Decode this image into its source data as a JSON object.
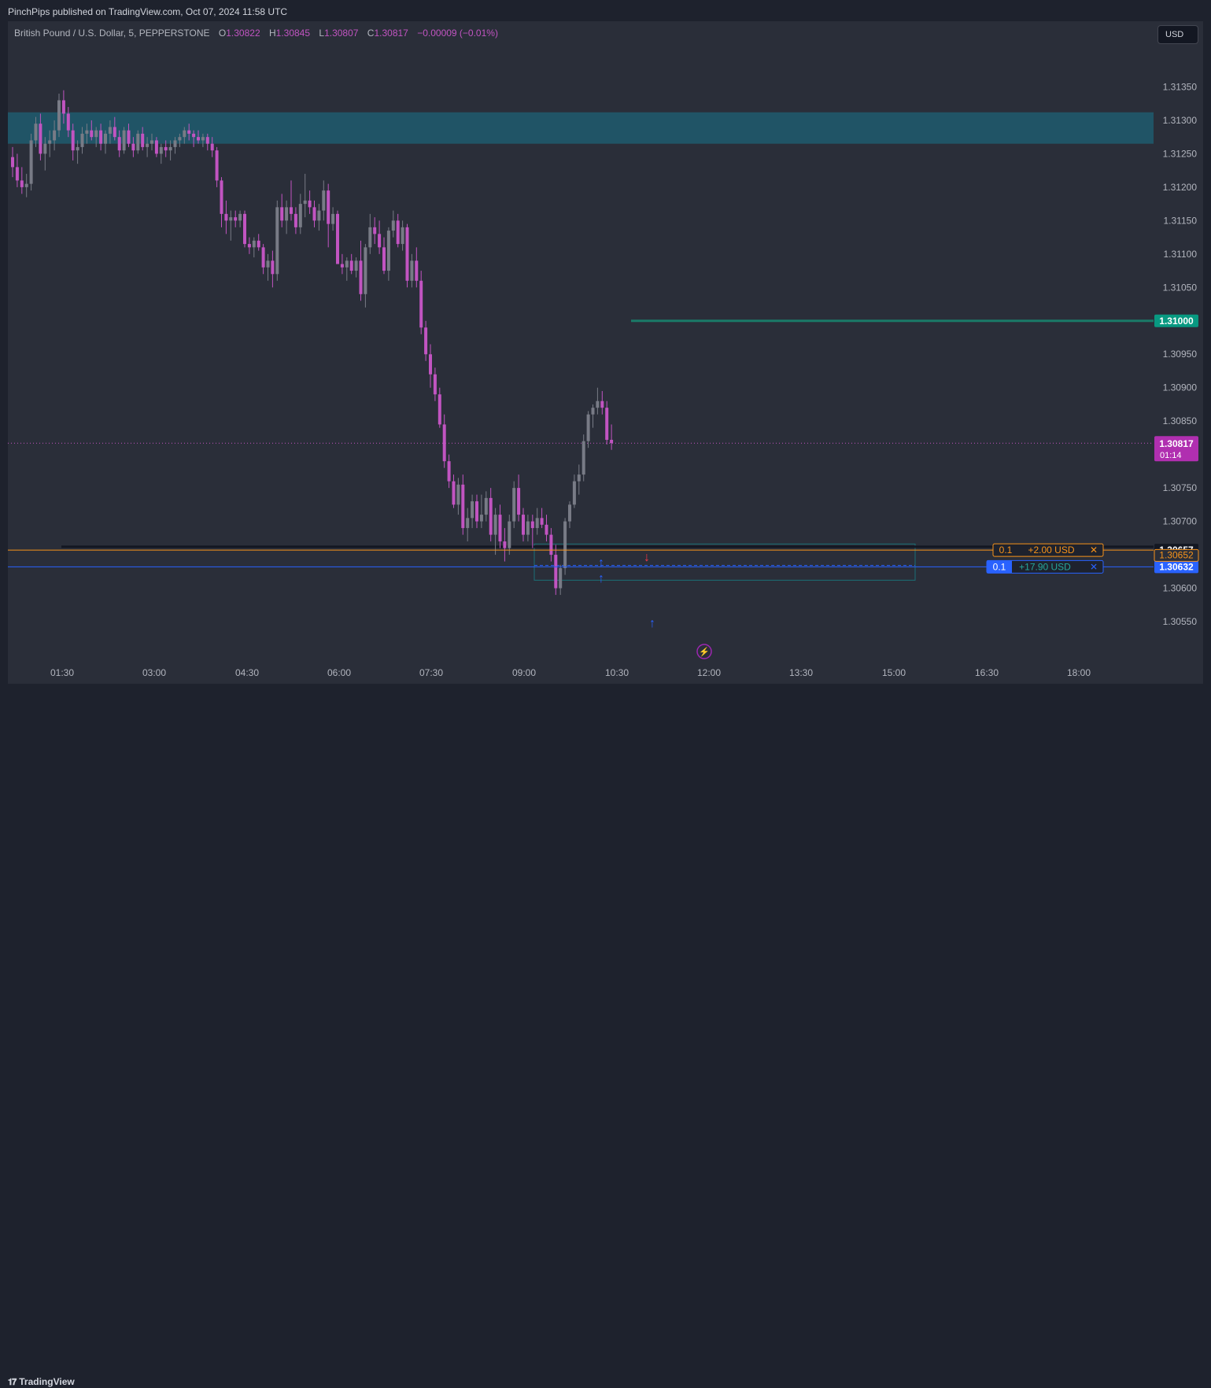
{
  "header": {
    "published": "PinchPips published on TradingView.com, Oct 07, 2024 11:58 UTC"
  },
  "legend": {
    "symbol": "British Pound / U.S. Dollar, 5, PEPPERSTONE",
    "open_label": "O",
    "open": "1.30822",
    "high_label": "H",
    "high": "1.30845",
    "low_label": "L",
    "low": "1.30807",
    "close_label": "C",
    "close": "1.30817",
    "change": "−0.00009 (−0.01%)"
  },
  "currency_button": "USD",
  "footer": {
    "brand": "TradingView"
  },
  "chart_data": {
    "type": "candlestick",
    "x_ticks": [
      "01:30",
      "03:00",
      "04:30",
      "06:00",
      "07:30",
      "09:00",
      "10:30",
      "12:00",
      "13:30",
      "15:00",
      "16:30",
      "18:00"
    ],
    "y_ticks": [
      "1.31350",
      "1.31300",
      "1.31250",
      "1.31200",
      "1.31150",
      "1.31100",
      "1.31050",
      "1.30950",
      "1.30900",
      "1.30850",
      "1.30750",
      "1.30700",
      "1.30600",
      "1.30550"
    ],
    "ylim": [
      1.3051,
      1.3142
    ],
    "colors": {
      "up": "#787b86",
      "down": "#c154c1",
      "zone": "#1f5b6e",
      "level": "#1a7a68",
      "order": "#f7931a",
      "position": "#2962ff"
    },
    "candles_ohlc": [
      [
        1.31245,
        1.3126,
        1.31215,
        1.3123
      ],
      [
        1.3123,
        1.3125,
        1.312,
        1.3121
      ],
      [
        1.3121,
        1.3123,
        1.3119,
        1.312
      ],
      [
        1.312,
        1.3122,
        1.31185,
        1.31205
      ],
      [
        1.31205,
        1.3128,
        1.31195,
        1.3127
      ],
      [
        1.3127,
        1.31305,
        1.3126,
        1.31295
      ],
      [
        1.31295,
        1.3131,
        1.3124,
        1.3125
      ],
      [
        1.3125,
        1.31275,
        1.31225,
        1.31265
      ],
      [
        1.31265,
        1.31285,
        1.31245,
        1.3127
      ],
      [
        1.3127,
        1.313,
        1.31255,
        1.31285
      ],
      [
        1.31285,
        1.3134,
        1.31275,
        1.3133
      ],
      [
        1.3133,
        1.31345,
        1.31295,
        1.3131
      ],
      [
        1.3131,
        1.3132,
        1.31275,
        1.31285
      ],
      [
        1.31285,
        1.31295,
        1.3124,
        1.31255
      ],
      [
        1.31255,
        1.3127,
        1.31235,
        1.3126
      ],
      [
        1.3126,
        1.3129,
        1.3125,
        1.3128
      ],
      [
        1.3128,
        1.31295,
        1.31265,
        1.31285
      ],
      [
        1.31285,
        1.313,
        1.3127,
        1.31275
      ],
      [
        1.31275,
        1.3129,
        1.3126,
        1.31285
      ],
      [
        1.31285,
        1.31295,
        1.31255,
        1.31265
      ],
      [
        1.31265,
        1.31285,
        1.3125,
        1.3128
      ],
      [
        1.3128,
        1.313,
        1.31265,
        1.3129
      ],
      [
        1.3129,
        1.31305,
        1.3127,
        1.31275
      ],
      [
        1.31275,
        1.31285,
        1.31245,
        1.31255
      ],
      [
        1.31255,
        1.3129,
        1.3125,
        1.31285
      ],
      [
        1.31285,
        1.31295,
        1.3126,
        1.31265
      ],
      [
        1.31265,
        1.31275,
        1.31245,
        1.31255
      ],
      [
        1.31255,
        1.31285,
        1.3125,
        1.3128
      ],
      [
        1.3128,
        1.3129,
        1.31255,
        1.3126
      ],
      [
        1.3126,
        1.31275,
        1.31245,
        1.31265
      ],
      [
        1.31265,
        1.3128,
        1.31255,
        1.3127
      ],
      [
        1.3127,
        1.31275,
        1.31245,
        1.3125
      ],
      [
        1.3125,
        1.31265,
        1.31235,
        1.3126
      ],
      [
        1.3126,
        1.3127,
        1.31245,
        1.31255
      ],
      [
        1.31255,
        1.3127,
        1.3124,
        1.3126
      ],
      [
        1.3126,
        1.31275,
        1.3125,
        1.3127
      ],
      [
        1.3127,
        1.3128,
        1.3126,
        1.31275
      ],
      [
        1.31275,
        1.3129,
        1.31265,
        1.31285
      ],
      [
        1.31285,
        1.31295,
        1.3127,
        1.3128
      ],
      [
        1.3128,
        1.31285,
        1.3126,
        1.31275
      ],
      [
        1.31275,
        1.31285,
        1.31265,
        1.3127
      ],
      [
        1.3127,
        1.3128,
        1.3126,
        1.31275
      ],
      [
        1.31275,
        1.3128,
        1.31255,
        1.31265
      ],
      [
        1.31265,
        1.31275,
        1.31245,
        1.31255
      ],
      [
        1.31255,
        1.3126,
        1.312,
        1.3121
      ],
      [
        1.3121,
        1.31215,
        1.3114,
        1.3116
      ],
      [
        1.3116,
        1.3118,
        1.3113,
        1.3115
      ],
      [
        1.3115,
        1.31165,
        1.3112,
        1.31155
      ],
      [
        1.31155,
        1.31165,
        1.3114,
        1.3115
      ],
      [
        1.3115,
        1.31165,
        1.3114,
        1.3116
      ],
      [
        1.3116,
        1.31165,
        1.3111,
        1.31115
      ],
      [
        1.31115,
        1.31125,
        1.311,
        1.3111
      ],
      [
        1.3111,
        1.31125,
        1.31095,
        1.3112
      ],
      [
        1.3112,
        1.3113,
        1.31105,
        1.3111
      ],
      [
        1.3111,
        1.31115,
        1.3107,
        1.3108
      ],
      [
        1.3108,
        1.311,
        1.3106,
        1.3109
      ],
      [
        1.3109,
        1.31105,
        1.3105,
        1.3107
      ],
      [
        1.3107,
        1.3118,
        1.3106,
        1.3117
      ],
      [
        1.3117,
        1.3119,
        1.3114,
        1.3115
      ],
      [
        1.3115,
        1.3118,
        1.3113,
        1.3117
      ],
      [
        1.3117,
        1.3121,
        1.3115,
        1.3116
      ],
      [
        1.3116,
        1.3117,
        1.3113,
        1.3114
      ],
      [
        1.3114,
        1.3119,
        1.3113,
        1.31175
      ],
      [
        1.31175,
        1.3122,
        1.31155,
        1.3118
      ],
      [
        1.3118,
        1.31195,
        1.3116,
        1.3117
      ],
      [
        1.3117,
        1.3118,
        1.3114,
        1.3115
      ],
      [
        1.3115,
        1.31175,
        1.31135,
        1.31165
      ],
      [
        1.31165,
        1.3121,
        1.3115,
        1.31195
      ],
      [
        1.31195,
        1.31205,
        1.3111,
        1.31145
      ],
      [
        1.31145,
        1.3117,
        1.31135,
        1.3116
      ],
      [
        1.3116,
        1.31165,
        1.3109,
        1.31085
      ],
      [
        1.31085,
        1.311,
        1.3107,
        1.3108
      ],
      [
        1.3108,
        1.31095,
        1.3106,
        1.3109
      ],
      [
        1.3109,
        1.311,
        1.3107,
        1.31075
      ],
      [
        1.31075,
        1.31095,
        1.31065,
        1.3109
      ],
      [
        1.3109,
        1.3112,
        1.3103,
        1.3104
      ],
      [
        1.3104,
        1.31115,
        1.3102,
        1.3111
      ],
      [
        1.3111,
        1.3116,
        1.311,
        1.3114
      ],
      [
        1.3114,
        1.31155,
        1.31115,
        1.3113
      ],
      [
        1.3113,
        1.3115,
        1.311,
        1.3111
      ],
      [
        1.3111,
        1.31125,
        1.3107,
        1.31075
      ],
      [
        1.31075,
        1.3114,
        1.3106,
        1.31135
      ],
      [
        1.31135,
        1.31165,
        1.31125,
        1.3115
      ],
      [
        1.3115,
        1.3116,
        1.3111,
        1.31115
      ],
      [
        1.31115,
        1.3115,
        1.31105,
        1.3114
      ],
      [
        1.3114,
        1.31145,
        1.3105,
        1.3106
      ],
      [
        1.3106,
        1.311,
        1.3105,
        1.3109
      ],
      [
        1.3109,
        1.3111,
        1.3105,
        1.3106
      ],
      [
        1.3106,
        1.31075,
        1.3098,
        1.3099
      ],
      [
        1.3099,
        1.31,
        1.3094,
        1.3095
      ],
      [
        1.3095,
        1.30965,
        1.309,
        1.3092
      ],
      [
        1.3092,
        1.3093,
        1.3088,
        1.3089
      ],
      [
        1.3089,
        1.309,
        1.3084,
        1.30845
      ],
      [
        1.30845,
        1.3086,
        1.3078,
        1.3079
      ],
      [
        1.3079,
        1.308,
        1.3075,
        1.3076
      ],
      [
        1.3076,
        1.3077,
        1.3072,
        1.30725
      ],
      [
        1.30725,
        1.30765,
        1.3071,
        1.30755
      ],
      [
        1.30755,
        1.3077,
        1.3068,
        1.3069
      ],
      [
        1.3069,
        1.3072,
        1.3067,
        1.30705
      ],
      [
        1.30705,
        1.3074,
        1.3069,
        1.3073
      ],
      [
        1.3073,
        1.3074,
        1.3069,
        1.307
      ],
      [
        1.307,
        1.3074,
        1.3069,
        1.3071
      ],
      [
        1.3071,
        1.30745,
        1.307,
        1.30735
      ],
      [
        1.30735,
        1.3075,
        1.3067,
        1.3068
      ],
      [
        1.3068,
        1.3072,
        1.3065,
        1.3071
      ],
      [
        1.3071,
        1.30725,
        1.3066,
        1.3067
      ],
      [
        1.3067,
        1.3069,
        1.3064,
        1.3066
      ],
      [
        1.3066,
        1.3071,
        1.3065,
        1.307
      ],
      [
        1.307,
        1.3076,
        1.3069,
        1.3075
      ],
      [
        1.3075,
        1.3077,
        1.307,
        1.3071
      ],
      [
        1.3071,
        1.3072,
        1.3067,
        1.3068
      ],
      [
        1.3068,
        1.3071,
        1.3067,
        1.307
      ],
      [
        1.307,
        1.3071,
        1.3066,
        1.3069
      ],
      [
        1.3069,
        1.3072,
        1.3068,
        1.30705
      ],
      [
        1.30705,
        1.3072,
        1.3069,
        1.30695
      ],
      [
        1.30695,
        1.3071,
        1.3067,
        1.3068
      ],
      [
        1.3068,
        1.3069,
        1.3064,
        1.3065
      ],
      [
        1.3065,
        1.30665,
        1.3059,
        1.306
      ],
      [
        1.306,
        1.30635,
        1.3059,
        1.3063
      ],
      [
        1.3063,
        1.30705,
        1.3062,
        1.307
      ],
      [
        1.307,
        1.3073,
        1.3069,
        1.30725
      ],
      [
        1.30725,
        1.3077,
        1.3072,
        1.3076
      ],
      [
        1.3076,
        1.30785,
        1.3074,
        1.3077
      ],
      [
        1.3077,
        1.3083,
        1.3076,
        1.3082
      ],
      [
        1.3082,
        1.30865,
        1.3081,
        1.3086
      ],
      [
        1.3086,
        1.30875,
        1.3084,
        1.3087
      ],
      [
        1.3087,
        1.309,
        1.3086,
        1.3088
      ],
      [
        1.3088,
        1.30895,
        1.3086,
        1.3087
      ],
      [
        1.3087,
        1.3088,
        1.30815,
        1.30822
      ],
      [
        1.30822,
        1.30845,
        1.30807,
        1.30817
      ]
    ],
    "resistance_zone": [
      1.31265,
      1.31312
    ],
    "level_line": {
      "price": 1.31,
      "label": "1.31000"
    },
    "current_price": {
      "price": 1.30817,
      "label": "1.30817",
      "countdown": "01:14"
    },
    "support_box": [
      1.306,
      1.30652
    ],
    "orders": [
      {
        "price": 1.30657,
        "label": "1.30657",
        "qty": "0.1",
        "pnl": "+2.00 USD",
        "close": "✕"
      },
      {
        "price": 1.30632,
        "label": "1.30632",
        "qty": "0.1",
        "pnl": "+17.90 USD",
        "close": "✕"
      }
    ],
    "support_box_label": "1.30652",
    "markers": [
      {
        "bar": 98,
        "dir": "up",
        "glyph": "↑"
      },
      {
        "bar": 98,
        "dir": "up",
        "glyph": "↑"
      },
      {
        "bar": 107,
        "dir": "down",
        "glyph": "↓"
      },
      {
        "bar": 108,
        "dir": "up",
        "glyph": "↑"
      }
    ],
    "event_icon": "⚡"
  }
}
